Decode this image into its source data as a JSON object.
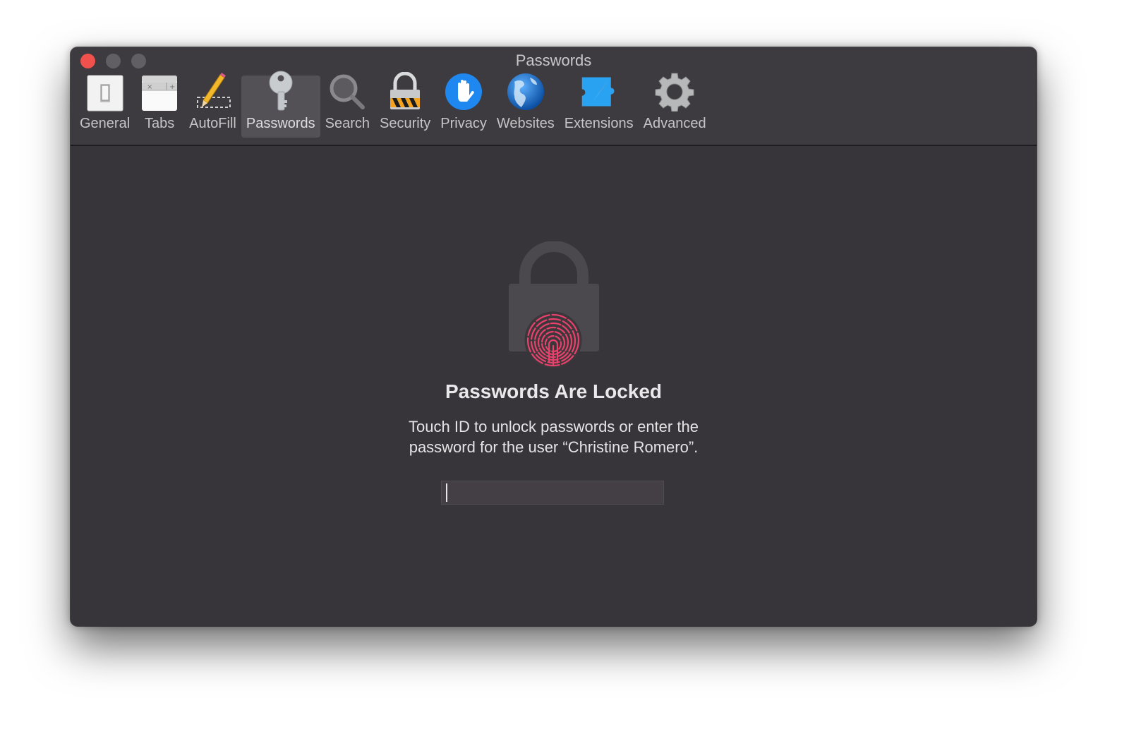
{
  "window": {
    "title": "Passwords",
    "controls": [
      "close",
      "minimize",
      "zoom"
    ]
  },
  "toolbar": {
    "items": [
      {
        "label": "General",
        "icon": "switch-icon",
        "active": false
      },
      {
        "label": "Tabs",
        "icon": "tabs-icon",
        "active": false
      },
      {
        "label": "AutoFill",
        "icon": "pencil-icon",
        "active": false
      },
      {
        "label": "Passwords",
        "icon": "key-icon",
        "active": true
      },
      {
        "label": "Search",
        "icon": "magnifier-icon",
        "active": false
      },
      {
        "label": "Security",
        "icon": "padlock-icon",
        "active": false
      },
      {
        "label": "Privacy",
        "icon": "hand-icon",
        "active": false
      },
      {
        "label": "Websites",
        "icon": "globe-icon",
        "active": false
      },
      {
        "label": "Extensions",
        "icon": "puzzle-compass-icon",
        "active": false
      },
      {
        "label": "Advanced",
        "icon": "gear-icon",
        "active": false
      }
    ]
  },
  "locked": {
    "heading": "Passwords Are Locked",
    "line1": "Touch ID to unlock passwords or enter the",
    "line2": "password for the user “Christine Romero”.",
    "password_value": "",
    "password_placeholder": ""
  },
  "colors": {
    "close": "#f1514c",
    "fingerprint": "#e8416c",
    "window_bg": "#38353a"
  }
}
